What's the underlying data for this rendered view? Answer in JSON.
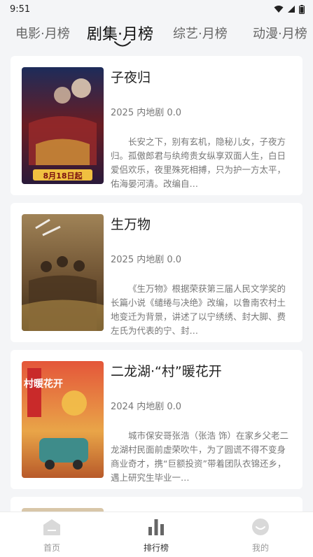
{
  "status": {
    "time": "9:51"
  },
  "tabs": [
    {
      "label": "电影·月榜",
      "active": false
    },
    {
      "label": "剧集·月榜",
      "active": true
    },
    {
      "label": "综艺·月榜",
      "active": false
    },
    {
      "label": "动漫·月榜",
      "active": false
    }
  ],
  "cards": [
    {
      "title": "子夜归",
      "meta": "2025 内地剧 0.0",
      "desc": "长安之下，别有玄机，隐秘儿女，子夜方归。孤傲郎君与纨绔贵女纵享双面人生，白日爱侣欢乐，夜里殊死相搏，只为护一方太平，佑海晏河清。改编自…",
      "poster_badge": "8月18日起",
      "poster_colors": [
        "#7a1d1d",
        "#2b3b6e"
      ]
    },
    {
      "title": "生万物",
      "meta": "2025 内地剧 0.0",
      "desc": "《生万物》根据荣获第三届人民文学奖的长篇小说《缱绻与决绝》改编，以鲁南农村土地变迁为背景，讲述了以宁绣绣、封大脚、费左氏为代表的宁、封…",
      "poster_colors": [
        "#8a6a3a",
        "#3b2c1c"
      ]
    },
    {
      "title": "二龙湖·“村”暖花开",
      "meta": "2024 内地剧 0.0",
      "desc": "城市保安哥张浩（张浩 饰）在家乡父老二龙湖村民面前虚荣吹牛，为了圆谎不得不变身商业奇才，携“巨额投资”带着团队衣锦还乡，遇上研究生毕业一…",
      "poster_badge": "村暖花开",
      "poster_colors": [
        "#d9452b",
        "#e8a23a"
      ]
    }
  ],
  "nav": [
    {
      "label": "首页",
      "icon": "home-icon",
      "active": false
    },
    {
      "label": "排行榜",
      "icon": "ranking-icon",
      "active": true
    },
    {
      "label": "我的",
      "icon": "profile-icon",
      "active": false
    }
  ]
}
